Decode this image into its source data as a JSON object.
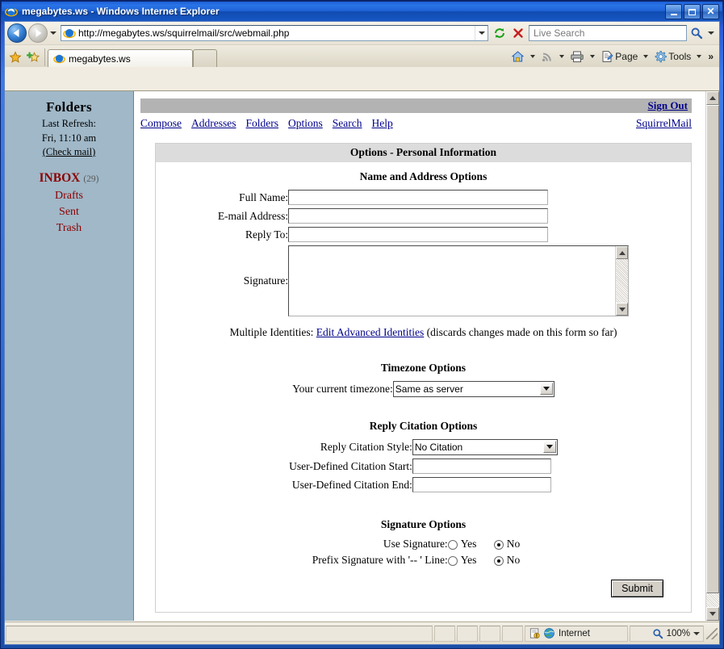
{
  "window": {
    "title": "megabytes.ws - Windows Internet Explorer",
    "minimize_label": "Minimize",
    "maximize_label": "Maximize",
    "close_label": "✕"
  },
  "browser": {
    "url": "http://megabytes.ws/squirrelmail/src/webmail.php",
    "search_placeholder": "Live Search",
    "back_label": "Back",
    "forward_label": "Forward",
    "refresh_label": "Refresh",
    "stop_label": "Stop",
    "tabs": [
      {
        "label": "megabytes.ws",
        "icon": "ie-favicon"
      },
      {
        "label": "",
        "icon": "new-tab"
      }
    ],
    "toolbar": [
      {
        "name": "home",
        "label": ""
      },
      {
        "name": "feeds",
        "label": ""
      },
      {
        "name": "print",
        "label": ""
      },
      {
        "name": "page",
        "label": "Page"
      },
      {
        "name": "tools",
        "label": "Tools"
      }
    ],
    "overflow_label": "»"
  },
  "statusbar": {
    "message": "",
    "zone": "Internet",
    "zoom": "100%"
  },
  "sidebar": {
    "title": "Folders",
    "last_refresh_label": "Last Refresh:",
    "last_refresh_time": "Fri, 11:10 am",
    "check_mail": "(Check mail)",
    "folders": [
      {
        "label": "INBOX",
        "count": "(29)",
        "bold": true
      },
      {
        "label": "Drafts",
        "count": "",
        "bold": false
      },
      {
        "label": "Sent",
        "count": "",
        "bold": false
      },
      {
        "label": "Trash",
        "count": "",
        "bold": false
      }
    ]
  },
  "mail": {
    "sign_out": "Sign Out",
    "brand": "SquirrelMail",
    "nav": [
      {
        "label": "Compose"
      },
      {
        "label": "Addresses"
      },
      {
        "label": "Folders"
      },
      {
        "label": "Options"
      },
      {
        "label": "Search"
      },
      {
        "label": "Help"
      }
    ],
    "page_title": "Options - Personal Information",
    "sections": {
      "name_address": {
        "heading": "Name and Address Options",
        "full_name_label": "Full Name:",
        "full_name_value": "",
        "email_label": "E-mail Address:",
        "email_value": "",
        "reply_to_label": "Reply To:",
        "reply_to_value": "",
        "signature_label": "Signature:",
        "signature_value": "",
        "multiple_identities_label": "Multiple Identities:",
        "edit_identities_link": "Edit Advanced Identities",
        "identities_note": "(discards changes made on this form so far)"
      },
      "timezone": {
        "heading": "Timezone Options",
        "label": "Your current timezone:",
        "selected": "Same as server",
        "options": [
          "Same as server"
        ]
      },
      "citation": {
        "heading": "Reply Citation Options",
        "style_label": "Reply Citation Style:",
        "style_selected": "No Citation",
        "style_options": [
          "No Citation"
        ],
        "start_label": "User-Defined Citation Start:",
        "start_value": "",
        "end_label": "User-Defined Citation End:",
        "end_value": ""
      },
      "signature": {
        "heading": "Signature Options",
        "use_signature_label": "Use Signature:",
        "use_signature_yes": "Yes",
        "use_signature_no": "No",
        "use_signature_selected": "No",
        "prefix_label": "Prefix Signature with '-- ' Line:",
        "prefix_yes": "Yes",
        "prefix_no": "No",
        "prefix_selected": "No"
      }
    },
    "submit_label": "Submit"
  },
  "colors": {
    "sidebar_bg": "#a0b8c8",
    "signout_bar": "#b3b3b3",
    "title_bar": "#dcdcdc",
    "link": "#00008b",
    "folder_link": "#8b0000",
    "titlebar_blue": "#2a74e8"
  }
}
